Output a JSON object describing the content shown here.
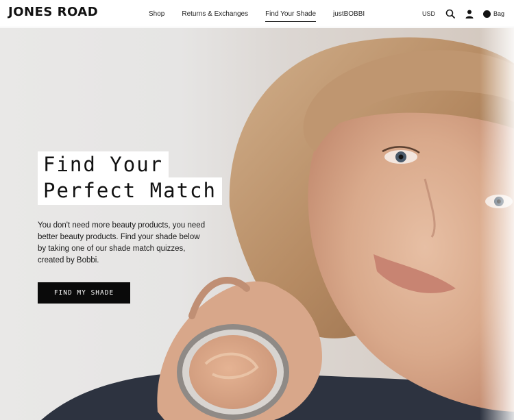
{
  "brand": {
    "logo_text": "JONES ROAD"
  },
  "nav": {
    "items": [
      {
        "label": "Shop"
      },
      {
        "label": "Returns & Exchanges"
      },
      {
        "label": "Find Your Shade"
      },
      {
        "label": "justBOBBI"
      }
    ],
    "active": "Find Your Shade"
  },
  "utils": {
    "currency": "USD",
    "search_icon": "search-icon",
    "account_icon": "user-icon",
    "bag_label": "Bag"
  },
  "hero": {
    "headline_line1": "Find Your",
    "headline_line2": "Perfect Match",
    "intro": "You don't need more beauty products, you need better beauty products. Find your shade below by taking one of our shade match quizzes, created by Bobbi.",
    "cta_label": "FIND MY SHADE",
    "image_subject": "woman holding open jar of foundation cream"
  },
  "colors": {
    "cta_bg": "#0a0a0a",
    "text": "#111111",
    "header_bg": "#ffffff"
  }
}
